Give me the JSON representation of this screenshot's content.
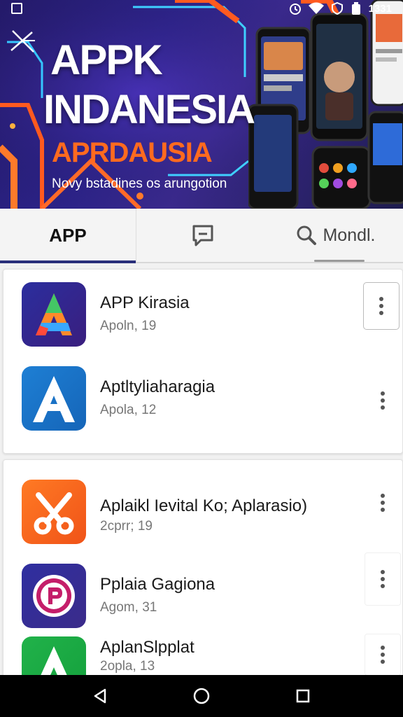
{
  "status_bar": {
    "time": "1331"
  },
  "hero": {
    "title_line1": "APPK",
    "title_line2": "INDANESIA",
    "subtitle": "APRDAUSIA",
    "tagline": "Novy bstadines os arungotion"
  },
  "tabs": [
    {
      "label": "APP",
      "icon": null,
      "selected": true
    },
    {
      "label": "",
      "icon": "chat-icon",
      "selected": false
    },
    {
      "label": "Mondl.",
      "icon": "search-icon",
      "selected": false
    }
  ],
  "apps": [
    {
      "name": "APP Kirasia",
      "meta": "Apoln, 19",
      "icon": "triangle-a-logo",
      "colors": [
        "#2b2e9e",
        "#3a1e7e"
      ]
    },
    {
      "name": "Aptltyliaharagia",
      "meta": "Apola, 12",
      "icon": "letter-a-logo",
      "colors": [
        "#1e7fd4",
        "#1565b8"
      ]
    },
    {
      "name": "Aplaikl Ievital Ko; Aplarasio)",
      "meta": "2cprr; 19",
      "icon": "scissors-logo",
      "colors": [
        "#ff7a24",
        "#f05318"
      ]
    },
    {
      "name": "Pplaia Gagiona",
      "meta": "Agom, 31",
      "icon": "letter-r-logo",
      "colors": [
        "#2f2fa0",
        "#3b2b8a"
      ]
    },
    {
      "name": "AplanSlpplat",
      "meta": "2opla, 13",
      "icon": "green-a-logo",
      "colors": [
        "#21b24a",
        "#14a03c"
      ]
    }
  ],
  "nav_bar": {
    "buttons": [
      "back-icon",
      "home-icon",
      "recents-icon"
    ]
  }
}
